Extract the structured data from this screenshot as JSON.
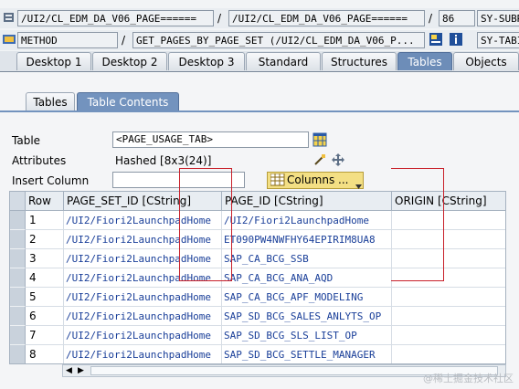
{
  "header": {
    "row1": {
      "field1": "/UI2/CL_EDM_DA_V06_PAGE======",
      "sep1": "/",
      "field2": "/UI2/CL_EDM_DA_V06_PAGE======",
      "sep2": "/",
      "field3": "86",
      "field4": "SY-SUBRC"
    },
    "row2": {
      "field1": "METHOD",
      "sep1": "/",
      "field2": "GET_PAGES_BY_PAGE_SET (/UI2/CL_EDM_DA_V06_P...",
      "field4": "SY-TABIX"
    }
  },
  "tabs": [
    "Desktop 1",
    "Desktop 2",
    "Desktop 3",
    "Standard",
    "Structures",
    "Tables",
    "Objects"
  ],
  "active_tab": "Tables",
  "subtabs": [
    "Tables",
    "Table Contents"
  ],
  "form": {
    "table_label": "Table",
    "table_value": "<PAGE_USAGE_TAB>",
    "attributes_label": "Attributes",
    "attributes_value": "Hashed [8x3(24)]",
    "insert_label": "Insert Column",
    "insert_value": "",
    "columns_button": "Columns ..."
  },
  "grid": {
    "columns": [
      "Row",
      "PAGE_SET_ID [CString]",
      "PAGE_ID [CString]",
      "ORIGIN [CString]"
    ],
    "rows": [
      {
        "row": "1",
        "page_set_id": "/UI2/Fiori2LaunchpadHome",
        "page_id": "/UI2/Fiori2LaunchpadHome",
        "origin": ""
      },
      {
        "row": "2",
        "page_set_id": "/UI2/Fiori2LaunchpadHome",
        "page_id": "ET090PW4NWFHY64EPIRIM8UA8",
        "origin": ""
      },
      {
        "row": "3",
        "page_set_id": "/UI2/Fiori2LaunchpadHome",
        "page_id": "SAP_CA_BCG_SSB",
        "origin": ""
      },
      {
        "row": "4",
        "page_set_id": "/UI2/Fiori2LaunchpadHome",
        "page_id": "SAP_CA_BCG_ANA_AQD",
        "origin": ""
      },
      {
        "row": "5",
        "page_set_id": "/UI2/Fiori2LaunchpadHome",
        "page_id": "SAP_CA_BCG_APF_MODELING",
        "origin": ""
      },
      {
        "row": "6",
        "page_set_id": "/UI2/Fiori2LaunchpadHome",
        "page_id": "SAP_SD_BCG_SALES_ANLYTS_OP",
        "origin": ""
      },
      {
        "row": "7",
        "page_set_id": "/UI2/Fiori2LaunchpadHome",
        "page_id": "SAP_SD_BCG_SLS_LIST_OP",
        "origin": ""
      },
      {
        "row": "8",
        "page_set_id": "/UI2/Fiori2LaunchpadHome",
        "page_id": "SAP_SD_BCG_SETTLE_MANAGER",
        "origin": ""
      }
    ]
  },
  "watermark": "@稀土掘金技术社区",
  "colors": {
    "accent": "#6d8db8",
    "columns_button": "#f3df84",
    "annotation": "#c8202a"
  }
}
